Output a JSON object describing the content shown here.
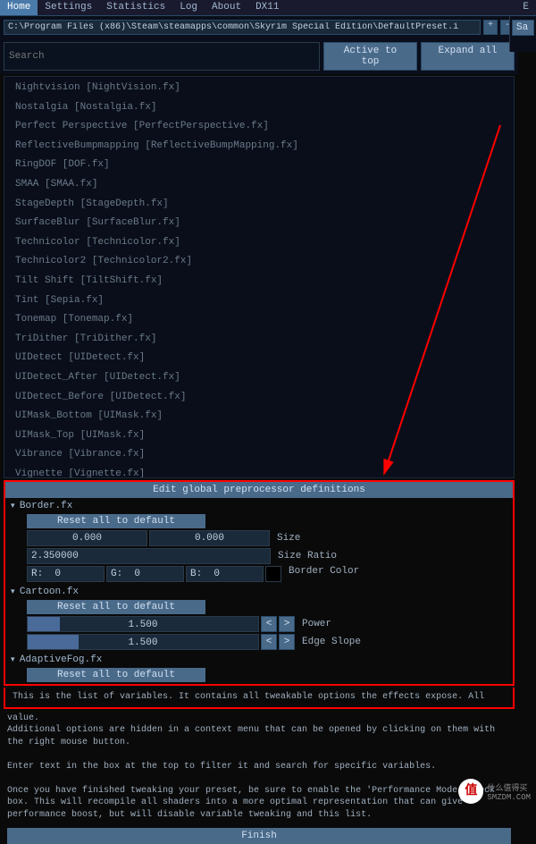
{
  "tabs": [
    "Home",
    "Settings",
    "Statistics",
    "Log",
    "About",
    "DX11"
  ],
  "right_tab": "E",
  "right_btn": "Sa",
  "path": "C:\\Program Files (x86)\\Steam\\steamapps\\common\\Skyrim Special Edition\\DefaultPreset.i",
  "path_btns": [
    "+",
    "-"
  ],
  "search_placeholder": "Search",
  "btn_active": "Active to top",
  "btn_expand": "Expand all",
  "effects": [
    "Nightvision [NightVision.fx]",
    "Nostalgia [Nostalgia.fx]",
    "Perfect Perspective [PerfectPerspective.fx]",
    "ReflectiveBumpmapping [ReflectiveBumpMapping.fx]",
    "RingDOF [DOF.fx]",
    "SMAA [SMAA.fx]",
    "StageDepth [StageDepth.fx]",
    "SurfaceBlur [SurfaceBlur.fx]",
    "Technicolor [Technicolor.fx]",
    "Technicolor2 [Technicolor2.fx]",
    "Tilt Shift [TiltShift.fx]",
    "Tint [Sepia.fx]",
    "Tonemap [Tonemap.fx]",
    "TriDither [TriDither.fx]",
    "UIDetect [UIDetect.fx]",
    "UIDetect_After [UIDetect.fx]",
    "UIDetect_Before [UIDetect.fx]",
    "UIMask_Bottom [UIMask.fx]",
    "UIMask_Top [UIMask.fx]",
    "Vibrance [Vibrance.fx]",
    "Vignette [Vignette.fx]"
  ],
  "editor": {
    "header": "Edit global preprocessor definitions",
    "border": {
      "title": "Border.fx",
      "reset": "Reset all to default",
      "size": {
        "x": "0.000",
        "y": "0.000",
        "label": "Size"
      },
      "ratio": {
        "val": "2.350000",
        "label": "Size Ratio"
      },
      "color": {
        "r": "R:  0",
        "g": "G:  0",
        "b": "B:  0",
        "label": "Border Color"
      }
    },
    "cartoon": {
      "title": "Cartoon.fx",
      "reset": "Reset all to default",
      "power": {
        "val": "1.500",
        "label": "Power"
      },
      "edge": {
        "val": "1.500",
        "label": "Edge Slope"
      }
    },
    "fog": {
      "title": "AdaptiveFog.fx",
      "reset": "Reset all to default"
    }
  },
  "info": {
    "line1": "This is the list of variables. It contains all tweakable options the effects expose. All",
    "line2": "value.",
    "line3": "Additional options are hidden in a context menu that can be opened by clicking on them with the right mouse button.",
    "line4": "Enter text in the box at the top to filter it and search for specific variables.",
    "line5": "Once you have finished tweaking your preset, be sure to enable the 'Performance Mode' check box. This will recompile all shaders into a more optimal representation that can give a performance boost, but will disable variable tweaking and this list."
  },
  "finish": "Finish",
  "watermark": {
    "chars": "值",
    "text1": "什么值得买",
    "text2": "SMZDM.COM"
  }
}
